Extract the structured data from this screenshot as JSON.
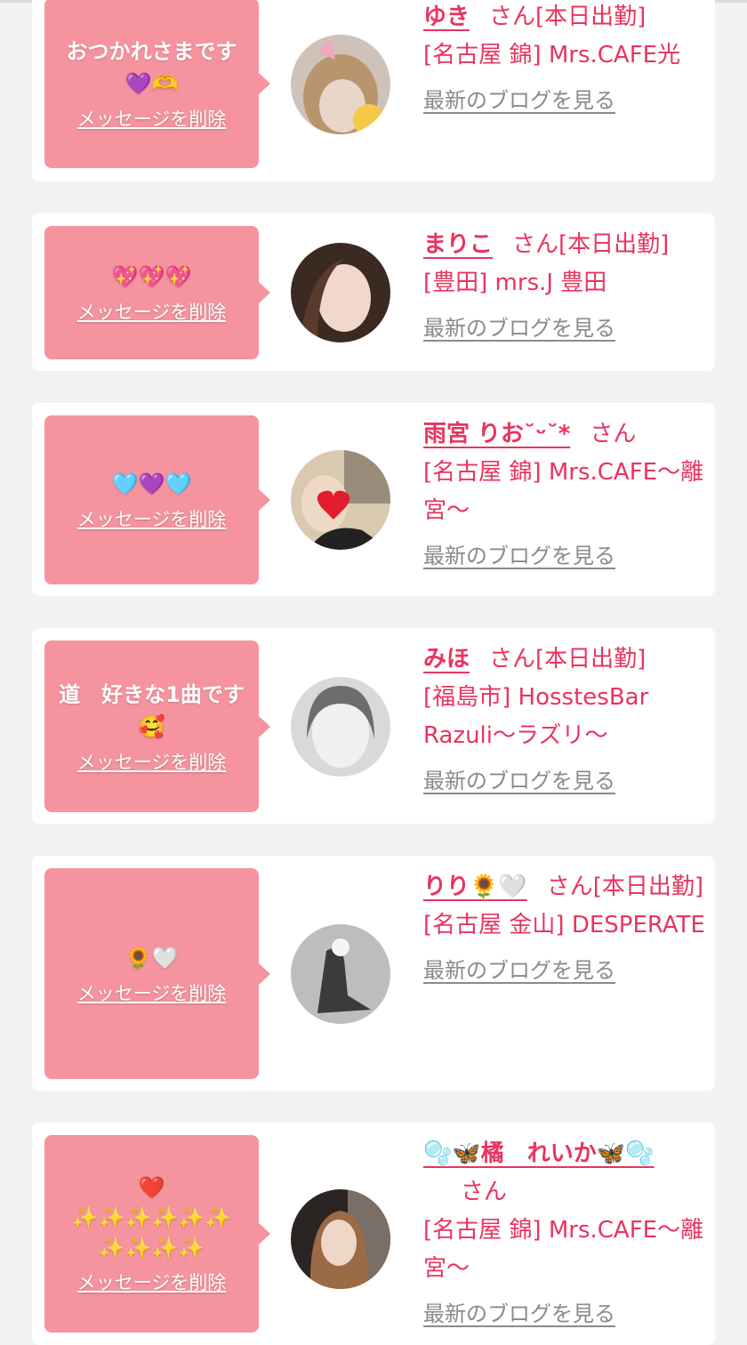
{
  "cards": [
    {
      "message": "おつかれさまです\n💜🫶",
      "delete_label": "メッセージを削除",
      "name": "ゆき",
      "san": "さん[本日出勤]",
      "shop": "[名古屋 錦] Mrs.CAFE光",
      "blog_label": "最新のブログを見る"
    },
    {
      "message": "💖💖💖",
      "delete_label": "メッセージを削除",
      "name": "まりこ",
      "san": "さん[本日出勤]",
      "shop": "[豊田] mrs.J 豊田",
      "blog_label": "最新のブログを見る"
    },
    {
      "message": "🩵💜🩵",
      "delete_label": "メッセージを削除",
      "name": "雨宮 りお˘ᵕ˘*",
      "san": "さん",
      "shop": "[名古屋 錦] Mrs.CAFE〜離宮〜",
      "blog_label": "最新のブログを見る"
    },
    {
      "message": "道　好きな1曲です🥰",
      "delete_label": "メッセージを削除",
      "name": "みほ",
      "san": "さん[本日出勤]",
      "shop": "[福島市] HosstesBar Razuli〜ラズリ〜",
      "blog_label": "最新のブログを見る"
    },
    {
      "message": "🌻🤍",
      "delete_label": "メッセージを削除",
      "name": "りり🌻🤍",
      "san": "さん[本日出勤]",
      "shop": "[名古屋 金山] DESPERATE",
      "blog_label": "最新のブログを見る"
    },
    {
      "message": "❤️\n✨✨✨✨✨✨\n✨✨✨✨",
      "delete_label": "メッセージを削除",
      "name": "🫧🦋橘　れいか🦋🫧",
      "san": "さん",
      "shop": "[名古屋 錦] Mrs.CAFE〜離宮〜",
      "blog_label": "最新のブログを見る"
    }
  ]
}
